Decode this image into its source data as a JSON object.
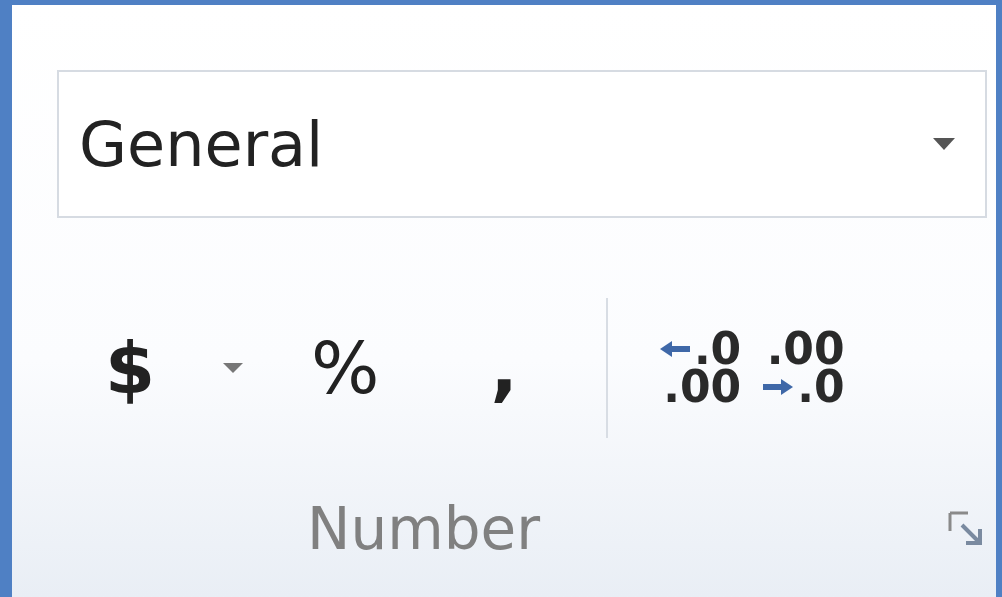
{
  "format_dropdown": {
    "value": "General"
  },
  "buttons": [
    {
      "kind": "symbol",
      "label": "$",
      "bold": true
    },
    {
      "kind": "caret"
    },
    {
      "kind": "symbol",
      "label": "%",
      "bold": false
    },
    {
      "kind": "symbol",
      "label": ",",
      "bold": true
    },
    {
      "kind": "separator"
    },
    {
      "kind": "increase",
      "lines": [
        ".0",
        ".00"
      ]
    },
    {
      "kind": "decrease",
      "lines": [
        ".00",
        ".0"
      ]
    }
  ],
  "group_label": "Number"
}
